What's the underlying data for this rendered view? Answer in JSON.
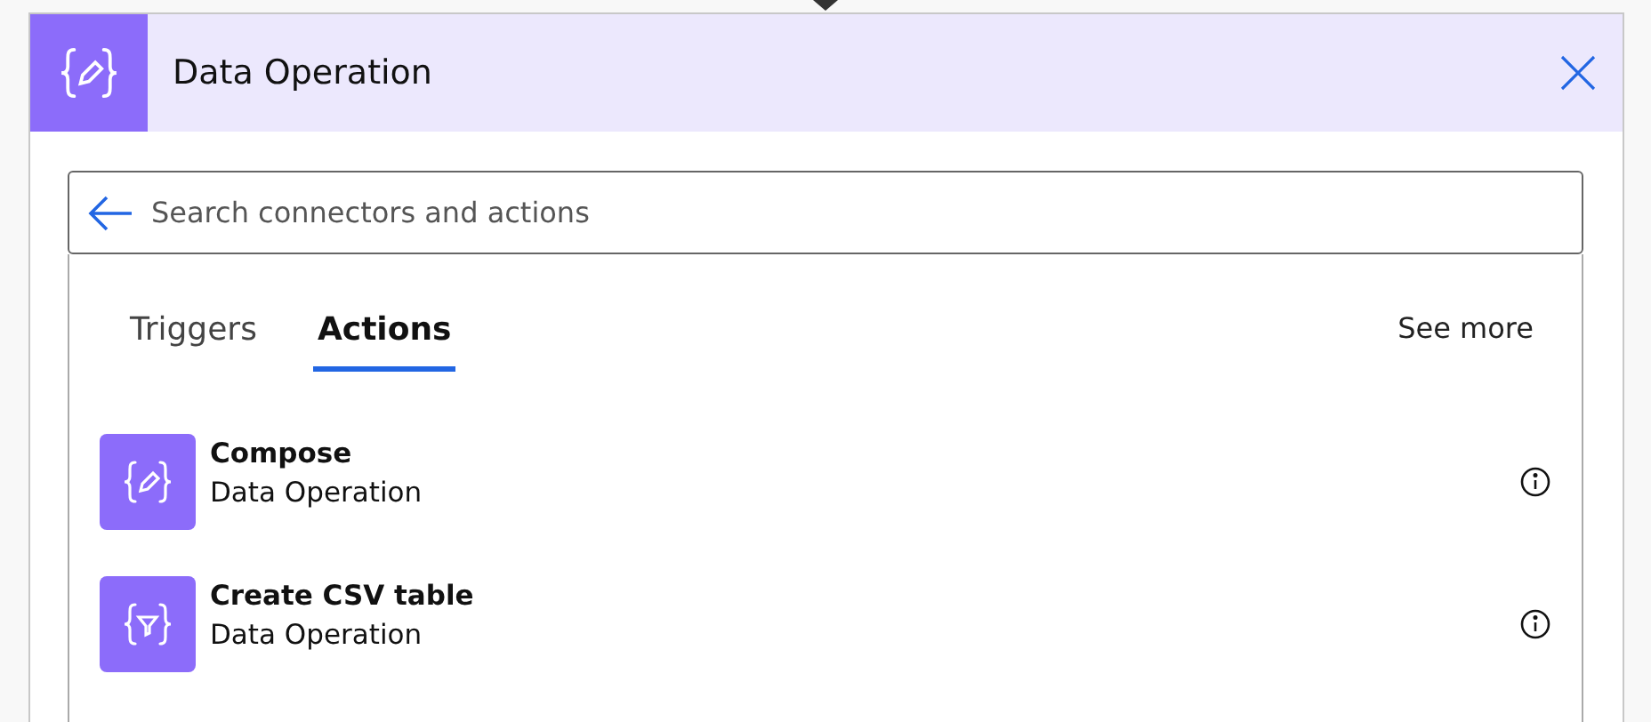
{
  "header": {
    "title": "Data Operation"
  },
  "search": {
    "placeholder": "Search connectors and actions"
  },
  "tabs": [
    {
      "label": "Triggers",
      "selected": false
    },
    {
      "label": "Actions",
      "selected": true
    }
  ],
  "see_more": "See more",
  "actions": [
    {
      "kind": "pencil",
      "name": "Compose",
      "connector": "Data Operation"
    },
    {
      "kind": "funnel",
      "name": "Create CSV table",
      "connector": "Data Operation"
    }
  ]
}
